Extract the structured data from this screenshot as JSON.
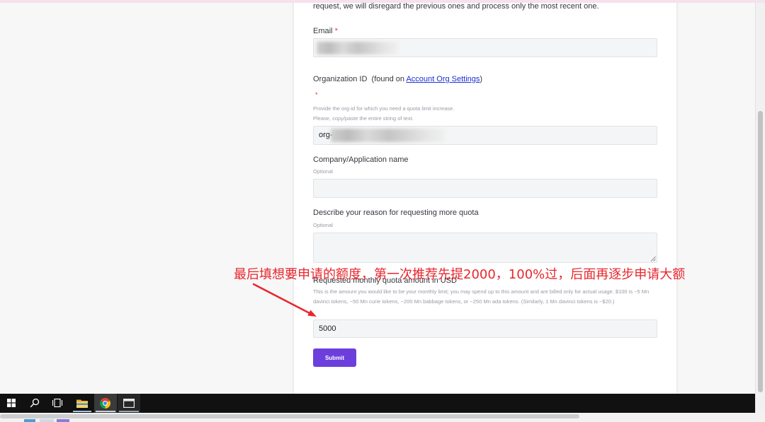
{
  "page": {
    "intro_tail": "request, we will disregard the previous ones and process only the most recent one."
  },
  "form": {
    "email": {
      "label": "Email",
      "required_mark": "*"
    },
    "org_id": {
      "label_prefix": "Organization ID  (found on ",
      "link_text": "Account Org Settings",
      "label_suffix": ")",
      "required_mark": "*",
      "help_lines": [
        "Provide the org-id for which you need a quota limit increase.",
        "Please, copy/paste the entire string of text."
      ],
      "value_prefix": "org-"
    },
    "company": {
      "label": "Company/Application name",
      "hint": "Optional"
    },
    "reason": {
      "label": "Describe your reason for requesting more quota",
      "hint": "Optional"
    },
    "quota": {
      "label": "Requested monthly quota amount in USD",
      "help": "This is the amount you would like to be your monthly limit; you may spend up to this amount and are billed only for actual usage. $100 is ~5 Mn davinci tokens, ~50 Mn curie tokens, ~200 Mn babbage tokens, or ~250 Mn ada tokens. (Similarly, 1 Mn davinci tokens is ~$20.)",
      "value": "5000"
    },
    "submit_label": "Submit"
  },
  "annotation": {
    "text": "最后填想要申请的额度，第一次推荐先提2000，100%过，后面再逐步申请大额"
  },
  "taskbar": {
    "icons": [
      "windows-start-icon",
      "search-icon",
      "task-view-icon",
      "file-explorer-icon",
      "chrome-icon",
      "terminal-icon"
    ]
  },
  "colors": {
    "accent": "#6c3fdd",
    "annotation": "#e8262c",
    "link": "#1b2fd6",
    "taskbar": "#111111"
  }
}
